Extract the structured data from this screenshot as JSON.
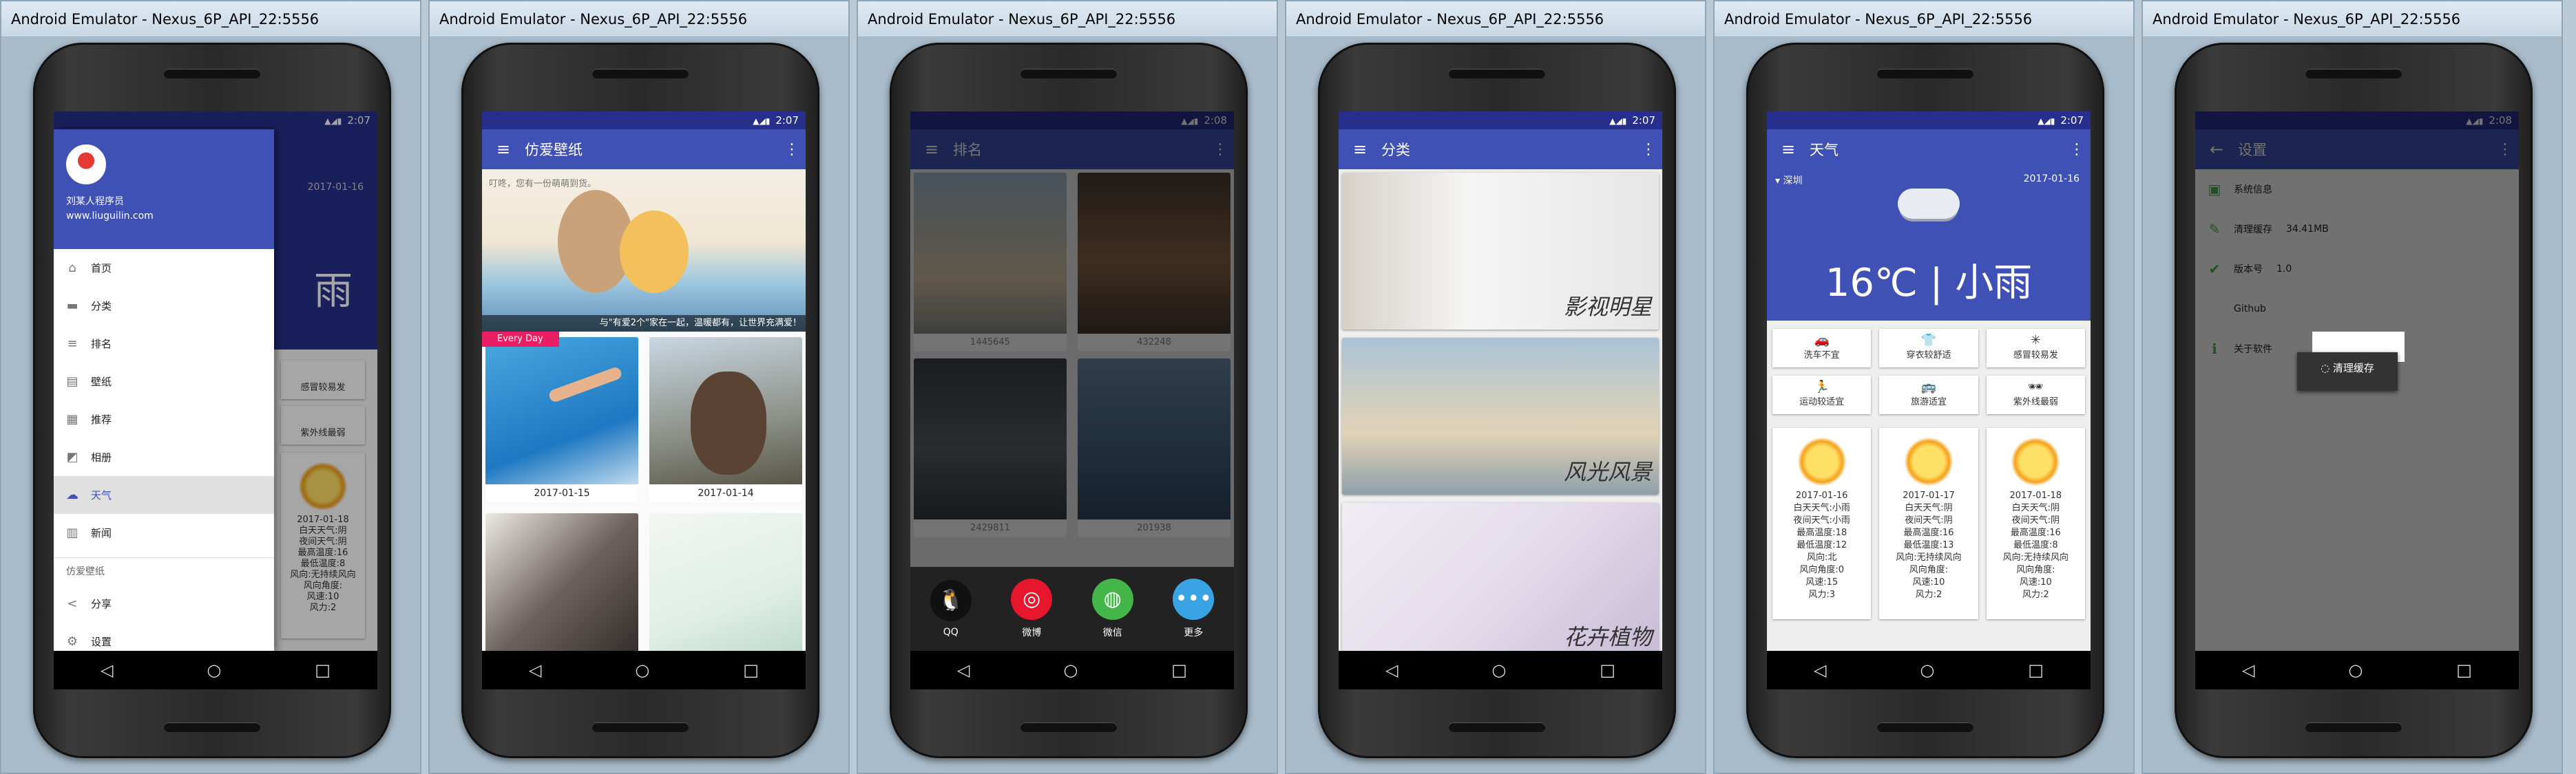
{
  "window_title": "Android Emulator - Nexus_6P_API_22:5556",
  "status": {
    "t1": "2:07",
    "t2": "2:07",
    "t3": "2:08",
    "t4": "2:07",
    "t5": "2:07",
    "t6": "2:08"
  },
  "nav": {
    "back": "◁",
    "home": "○",
    "recent": "□"
  },
  "s1": {
    "user": "刘某人程序员",
    "site": "www.liuguilin.com",
    "date": "2017-01-16",
    "big": "雨",
    "items": [
      {
        "icon": "home-icon",
        "glyph": "⌂",
        "label": "首页"
      },
      {
        "icon": "category-icon",
        "glyph": "▬",
        "label": "分类"
      },
      {
        "icon": "rank-icon",
        "glyph": "≡",
        "label": "排名"
      },
      {
        "icon": "wallpaper-icon",
        "glyph": "▤",
        "label": "壁纸"
      },
      {
        "icon": "recommend-icon",
        "glyph": "▦",
        "label": "推荐"
      },
      {
        "icon": "album-icon",
        "glyph": "◩",
        "label": "相册"
      },
      {
        "icon": "weather-icon",
        "glyph": "☁",
        "label": "天气"
      },
      {
        "icon": "news-icon",
        "glyph": "▥",
        "label": "新闻"
      }
    ],
    "section": "仿爱壁纸",
    "share": "分享",
    "settings": "设置",
    "bg_cells": [
      "感冒较易发",
      "紫外线最弱"
    ],
    "bg_text": "2017-01-18\n白天天气:阴\n夜间天气:阴\n最高温度:16\n最低温度:8\n风向:无持续风向\n风向角度:\n风速:10\n风力:2"
  },
  "s2": {
    "title": "仿爱壁纸",
    "banner_text": "叮咚，您有一份萌萌到货。",
    "banner_caption": "与\"有爱2个\"家在一起，温暖都有，让世界充满爱！",
    "badge": "Every Day",
    "cards": [
      {
        "date": "2017-01-15"
      },
      {
        "date": "2017-01-14"
      }
    ]
  },
  "s3": {
    "title": "排名",
    "counts": [
      "1445645",
      "432248",
      "2429811",
      "201938"
    ],
    "share": [
      {
        "icon": "qq-icon",
        "glyph": "🐧",
        "label": "QQ",
        "color": "#111111"
      },
      {
        "icon": "weibo-icon",
        "glyph": "◎",
        "label": "微博",
        "color": "#e6162d"
      },
      {
        "icon": "wechat-icon",
        "glyph": "◍",
        "label": "微信",
        "color": "#44b549"
      },
      {
        "icon": "more-icon",
        "glyph": "•••",
        "label": "更多",
        "color": "#3aa3e3"
      }
    ]
  },
  "s4": {
    "title": "分类",
    "cats": [
      "影视明星",
      "风光风景",
      "花卉植物"
    ]
  },
  "s5": {
    "title": "天气",
    "city": "▾ 深圳",
    "date": "2017-01-16",
    "temp": "16℃ | 小雨",
    "tips": [
      {
        "icon": "car-icon",
        "glyph": "🚗",
        "label": "洗车不宜"
      },
      {
        "icon": "clothes-icon",
        "glyph": "👕",
        "label": "穿衣较舒适"
      },
      {
        "icon": "virus-icon",
        "glyph": "✳",
        "label": "感冒较易发"
      },
      {
        "icon": "sport-icon",
        "glyph": "🏃",
        "label": "运动较适宜"
      },
      {
        "icon": "travel-icon",
        "glyph": "🚌",
        "label": "旅游适宜"
      },
      {
        "icon": "sunglasses-icon",
        "glyph": "🕶",
        "label": "紫外线最弱"
      }
    ],
    "days": [
      {
        "date": "2017-01-16",
        "l1": "白天天气:小雨",
        "l2": "夜间天气:小雨",
        "l3": "最高温度:18",
        "l4": "最低温度:12",
        "l5": "风向:北",
        "l6": "风向角度:0",
        "l7": "风速:15",
        "l8": "风力:3"
      },
      {
        "date": "2017-01-17",
        "l1": "白天天气:阴",
        "l2": "夜间天气:阴",
        "l3": "最高温度:16",
        "l4": "最低温度:13",
        "l5": "风向:无持续风向",
        "l6": "风向角度:",
        "l7": "风速:10",
        "l8": "风力:2"
      },
      {
        "date": "2017-01-18",
        "l1": "白天天气:阴",
        "l2": "夜间天气:阴",
        "l3": "最高温度:16",
        "l4": "最低温度:8",
        "l5": "风向:无持续风向",
        "l6": "风向角度:",
        "l7": "风速:10",
        "l8": "风力:2"
      }
    ]
  },
  "s6": {
    "title": "设置",
    "back": "←",
    "rows": [
      {
        "icon": "system-info-icon",
        "glyph": "▣",
        "label": "系统信息",
        "value": ""
      },
      {
        "icon": "clear-cache-icon",
        "glyph": "✎",
        "label": "清理缓存",
        "value": "34.41MB"
      },
      {
        "icon": "version-icon",
        "glyph": "✔",
        "label": "版本号",
        "value": "1.0"
      },
      {
        "icon": "github-icon",
        "glyph": "",
        "label": "Github",
        "value": ""
      },
      {
        "icon": "about-icon",
        "glyph": "ℹ",
        "label": "关于软件",
        "value": ""
      }
    ],
    "dialog": "清理缓存"
  }
}
